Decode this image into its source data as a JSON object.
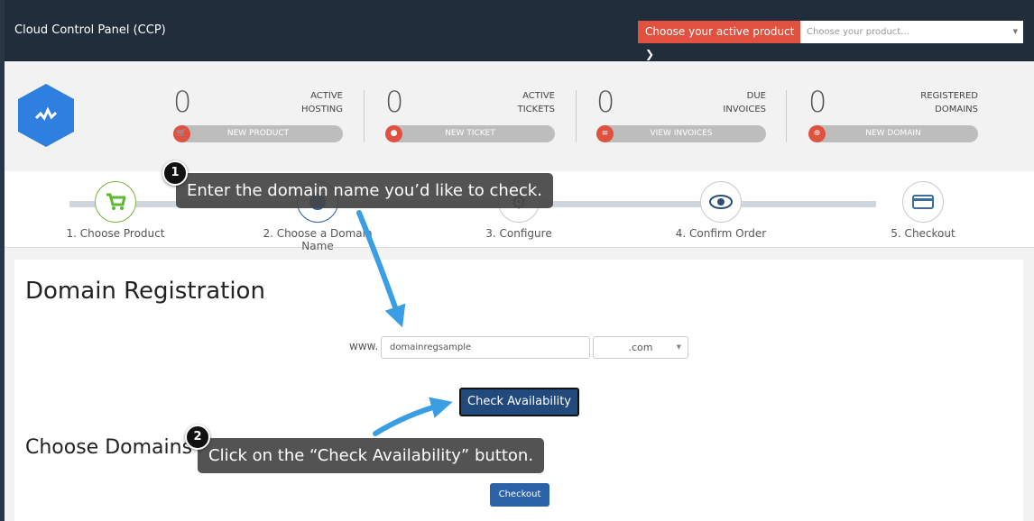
{
  "header": {
    "title": "Cloud Control Panel (CCP)",
    "active_product_label": "Choose your active product ❯",
    "product_select_placeholder": "Choose your product..."
  },
  "stats": [
    {
      "value": "0",
      "label1": "ACTIVE",
      "label2": "HOSTING",
      "button": "NEW PRODUCT",
      "icon": "cart-icon"
    },
    {
      "value": "0",
      "label1": "ACTIVE",
      "label2": "TICKETS",
      "button": "NEW TICKET",
      "icon": "chat-icon"
    },
    {
      "value": "0",
      "label1": "DUE",
      "label2": "INVOICES",
      "button": "VIEW INVOICES",
      "icon": "list-icon"
    },
    {
      "value": "0",
      "label1": "REGISTERED",
      "label2": "DOMAINS",
      "button": "NEW DOMAIN",
      "icon": "globe-icon"
    }
  ],
  "steps": [
    {
      "label": "1. Choose Product",
      "icon": "cart-icon",
      "state": "done"
    },
    {
      "label": "2. Choose a Domain Name",
      "icon": "globe-icon",
      "state": "active"
    },
    {
      "label": "3. Configure",
      "icon": "gears-icon",
      "state": "pending"
    },
    {
      "label": "4. Confirm Order",
      "icon": "eye-icon",
      "state": "pending"
    },
    {
      "label": "5. Checkout",
      "icon": "credit-card-icon",
      "state": "pending"
    }
  ],
  "main": {
    "title": "Domain Registration",
    "www_label": "www.",
    "domain_value": "domainregsample",
    "tld_value": ".com",
    "check_button": "Check Availability",
    "choose_domains_title": "Choose Domains",
    "checkout_button": "Checkout"
  },
  "callouts": [
    {
      "number": "1",
      "text": "Enter the domain name you’d like to check."
    },
    {
      "number": "2",
      "text": "Click on the “Check Availability” button."
    }
  ],
  "colors": {
    "accent_red": "#e05140",
    "brand_blue": "#2f7fe0",
    "primary_button": "#22497c",
    "arrow": "#3a9ee4",
    "topbar": "#222d3c"
  }
}
